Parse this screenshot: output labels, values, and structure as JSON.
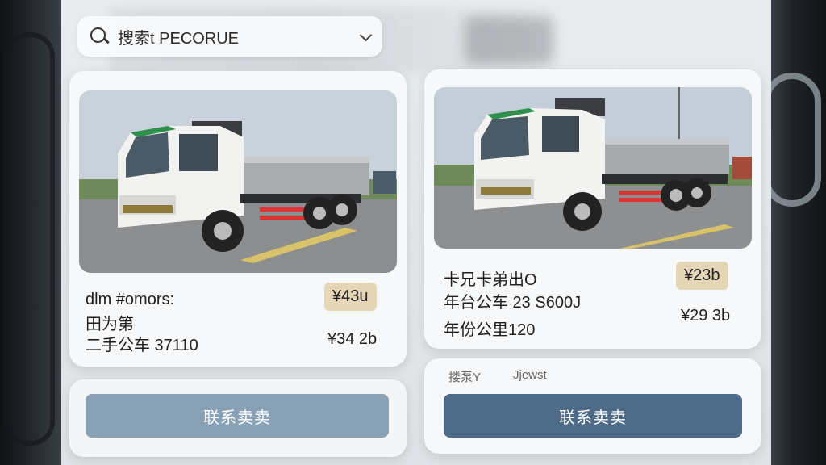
{
  "search": {
    "placeholder": "搜索t PECORUE"
  },
  "listings": [
    {
      "line1": "dlm #omors:",
      "line2": "田为第",
      "line3": "二手公车 37110",
      "tag_price": "¥43u",
      "price": "¥34 2b"
    },
    {
      "line1": "卡兄卡弟出O",
      "line2": "年台公车 23 S600J",
      "line3": "年份公里120",
      "tag_price": "¥23b",
      "price": "¥29 3b"
    }
  ],
  "footer_right": {
    "label_a": "搂泵Y",
    "label_b": "Jjewst"
  },
  "buttons": {
    "contact_left": "联系卖卖",
    "contact_right": "联系卖卖"
  },
  "colors": {
    "price_tag": "#e6d6b8",
    "button_primary": "#4d6a86",
    "button_faded": "#8aa0b4",
    "truck_green": "#2f8f4e"
  }
}
